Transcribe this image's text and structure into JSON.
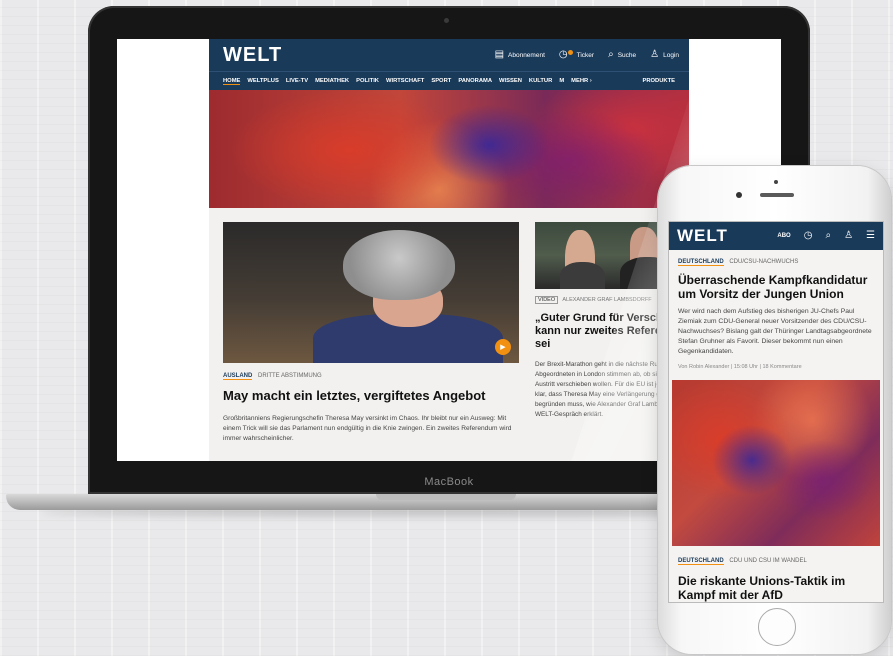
{
  "laptop": {
    "brand": "MacBook"
  },
  "desktop": {
    "logo": "WELT",
    "top_actions": [
      {
        "icon": "newspaper-icon",
        "label": "Abonnement"
      },
      {
        "icon": "ticker-clock-icon",
        "label": "Ticker"
      },
      {
        "icon": "search-icon",
        "label": "Suche"
      },
      {
        "icon": "user-icon",
        "label": "Login"
      }
    ],
    "nav": [
      "HOME",
      "WELTPLUS",
      "LIVE-TV",
      "MEDIATHEK",
      "POLITIK",
      "WIRTSCHAFT",
      "SPORT",
      "PANORAMA",
      "WISSEN",
      "KULTUR",
      "M"
    ],
    "nav_more": "MEHR ›",
    "nav_products": "PRODUKTE",
    "main_article": {
      "tag": "AUSLAND",
      "kicker": "DRITTE ABSTIMMUNG",
      "headline": "May macht ein letztes, vergiftetes Angebot",
      "teaser": "Großbritanniens Regierungschefin Theresa May versinkt im Chaos. Ihr bleibt nur ein Ausweg: Mit einem Trick will sie das Parlament nun endgültig in die Knie zwingen. Ein zweites Referendum wird immer wahrscheinlicher."
    },
    "side_article": {
      "badge": "VIDEO",
      "author": "ALEXANDER GRAF LAMBSDORFF",
      "headline": "„Guter Grund für Verschiebung kann nur zweites Referendum sei",
      "teaser": "Der Brexit-Marathon geht in die nächste Runde: Die Abgeordneten in London stimmen ab, ob sie den Austritt verschieben wollen. Für die EU ist jedoch klar, dass Theresa May eine Verlängerung gut begründen muss, wie Alexander Graf Lambsdorff im WELT-Gespräch erklärt."
    }
  },
  "mobile": {
    "logo": "WELT",
    "abo": "ABO",
    "article1": {
      "tag": "DEUTSCHLAND",
      "kicker": "CDU/CSU-NACHWUCHS",
      "headline": "Überraschende Kampfkandidatur um Vorsitz der Jungen Union",
      "teaser": "Wer wird nach dem Aufstieg des bisherigen JU-Chefs Paul Ziemiak zum CDU-General neuer Vorsitzender des CDU/CSU-Nachwuchses? Bislang galt der Thüringer Landtagsabgeordnete Stefan Gruhner als Favorit. Dieser bekommt nun einen Gegenkandidaten.",
      "meta": "Von Robin Alexander | 15:08 Uhr | 18 Kommentare"
    },
    "article2": {
      "tag": "DEUTSCHLAND",
      "kicker": "CDU UND CSU IM WANDEL",
      "headline": "Die riskante Unions-Taktik im Kampf mit der AfD"
    }
  }
}
